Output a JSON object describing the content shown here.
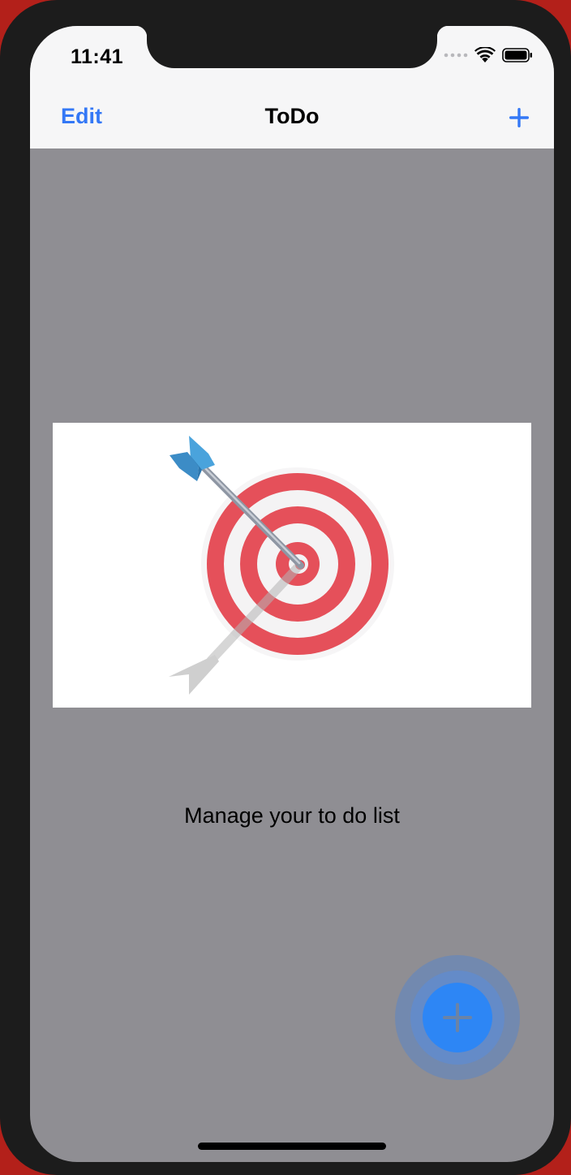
{
  "status_bar": {
    "time": "11:41",
    "icons": [
      "signal-icon",
      "wifi-icon",
      "battery-icon"
    ]
  },
  "nav_bar": {
    "edit_label": "Edit",
    "title": "ToDo",
    "add_icon": "plus-icon"
  },
  "empty_state": {
    "illustration": "target-with-arrow",
    "message": "Manage your to do list"
  },
  "fab": {
    "icon": "plus-icon"
  },
  "colors": {
    "accent": "#3478f6",
    "fab": "#2d86f5",
    "background": "#8f8e93",
    "nav_background": "#f6f6f7",
    "target_red": "#e5505a"
  }
}
